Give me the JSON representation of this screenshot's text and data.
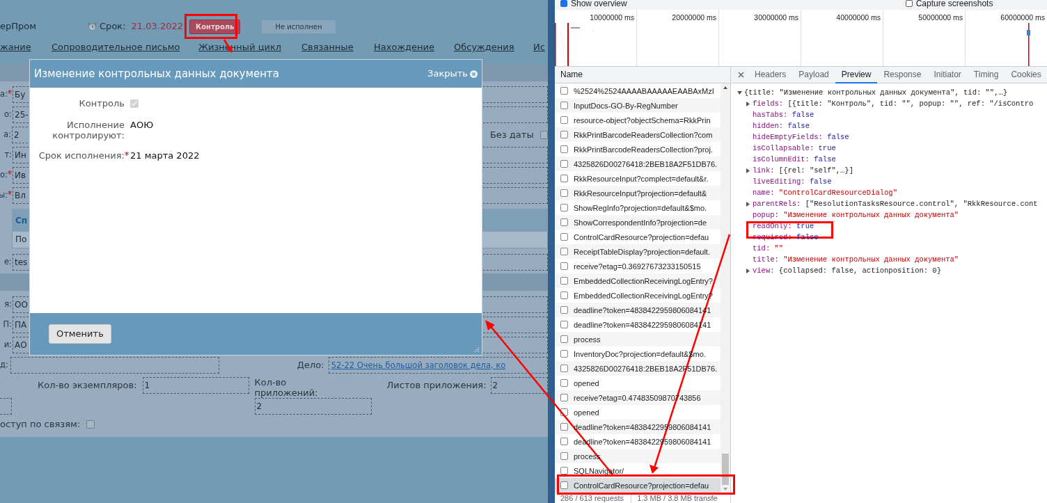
{
  "page": {
    "header": {
      "org": "ерПром",
      "deadline_label": "Срок:",
      "deadline": "21.03.2022",
      "control_button": "Контроль",
      "status": "Не исполнен"
    },
    "tabs": [
      {
        "label": "жание"
      },
      {
        "label": "Сопроводительное письмо"
      },
      {
        "label": "Жизненный цикл"
      },
      {
        "label": "Связанные"
      },
      {
        "label": "Нахождение"
      },
      {
        "label": "Обсуждения"
      },
      {
        "label": "Ис"
      }
    ],
    "form_rows": [
      {
        "label": "а:",
        "required": true,
        "value": "Бу"
      },
      {
        "label": "о:",
        "required": false,
        "value": "25-"
      },
      {
        "label": "а:",
        "required": false,
        "value": "2"
      },
      {
        "label": "т:",
        "required": false,
        "value": "Ин"
      },
      {
        "label": "о:",
        "required": true,
        "value": "Ив"
      },
      {
        "label": "ы:",
        "required": true,
        "value": "Вл"
      }
    ],
    "no_date": {
      "label": "Без даты",
      "checked": false
    },
    "table": {
      "header": "Сп",
      "row": "По"
    },
    "note_row": {
      "label": "е:",
      "value": "tes"
    },
    "second_rows": [
      {
        "label": "я:",
        "value": "ОО"
      },
      {
        "label": "П:",
        "value": "ПА"
      },
      {
        "label": "и:",
        "value": "АО"
      }
    ],
    "case_row": {
      "label": "д:",
      "case_label": "Дело:",
      "case_link": "52-22 Очень большой заголовок дела, ко"
    },
    "counts": [
      {
        "label": "Кол-во экземпляров:",
        "value": "1"
      },
      {
        "label": "Кол-во приложений:",
        "value": "2"
      },
      {
        "label": "Листов приложения:",
        "value": "2"
      }
    ],
    "access": {
      "label": "оступ по связям:",
      "checked": false
    }
  },
  "dialog": {
    "title": "Изменение контрольных данных документа",
    "close": "Закрыть",
    "fields": [
      {
        "kind": "checkbox",
        "label": "Контроль",
        "checked": true,
        "disabled": true
      },
      {
        "kind": "text",
        "label": "Исполнение контролируют:",
        "required": false,
        "value": "АОЮ"
      },
      {
        "kind": "text",
        "label": "Срок исполнения:",
        "required": true,
        "value": "21 марта 2022"
      }
    ],
    "cancel": "Отменить"
  },
  "devtools": {
    "options": [
      {
        "label": "Show overview",
        "checked": true
      },
      {
        "label": "Capture screenshots",
        "checked": false
      }
    ],
    "timeline_ticks": [
      "10000000 ms",
      "20000000 ms",
      "30000000 ms",
      "40000000 ms",
      "50000000 ms",
      "60000000 ms"
    ],
    "name_header": "Name",
    "requests": [
      {
        "name": "%2524%2524AAAABAAAAAEAABAxMzI",
        "selected": false
      },
      {
        "name": "InputDocs-GO-By-RegNumber",
        "selected": false
      },
      {
        "name": "resource-object?objectSchema=RkkPrin",
        "selected": false
      },
      {
        "name": "RkkPrintBarcodeReadersCollection?com",
        "selected": false
      },
      {
        "name": "RkkPrintBarcodeReadersCollection?proj.",
        "selected": false
      },
      {
        "name": "4325826D00276418:2BEB18A2F51DB76.",
        "selected": false
      },
      {
        "name": "RkkResourceInput?complect=default&r.",
        "selected": false
      },
      {
        "name": "RkkResourceInput?projection=default&",
        "selected": false
      },
      {
        "name": "ShowRegInfo?projection=default&$mo.",
        "selected": false
      },
      {
        "name": "ShowCorrespondentInfo?projection=de",
        "selected": false
      },
      {
        "name": "ControlCardResource?projection=defau",
        "selected": false
      },
      {
        "name": "ReceiptTableDisplay?projection=default.",
        "selected": false
      },
      {
        "name": "receive?etag=0.36927673233150515",
        "selected": false
      },
      {
        "name": "EmbeddedCollectionReceivingLogEntry?",
        "selected": false
      },
      {
        "name": "EmbeddedCollectionReceivingLogEntry?",
        "selected": false
      },
      {
        "name": "deadline?token=4838422959806084141",
        "selected": false
      },
      {
        "name": "deadline?token=4838422959806084141",
        "selected": false
      },
      {
        "name": "process",
        "selected": false
      },
      {
        "name": "InventoryDoc?projection=default&$mo.",
        "selected": false
      },
      {
        "name": "4325826D00276418:2BEB18A2F51DB76.",
        "selected": false
      },
      {
        "name": "opened",
        "selected": false
      },
      {
        "name": "receive?etag=0.47483509870743856",
        "selected": false
      },
      {
        "name": "opened",
        "selected": false
      },
      {
        "name": "deadline?token=4838422959806084141",
        "selected": false
      },
      {
        "name": "deadline?token=4838422959806084141",
        "selected": false
      },
      {
        "name": "process",
        "selected": false
      },
      {
        "name": "SQLNavigator/",
        "selected": false
      },
      {
        "name": "ControlCardResource?projection=defau",
        "selected": true
      }
    ],
    "tabs": [
      {
        "label": "Headers",
        "selected": false
      },
      {
        "label": "Payload",
        "selected": false
      },
      {
        "label": "Preview",
        "selected": true
      },
      {
        "label": "Response",
        "selected": false
      },
      {
        "label": "Initiator",
        "selected": false
      },
      {
        "label": "Timing",
        "selected": false
      },
      {
        "label": "Cookies",
        "selected": false
      }
    ],
    "preview": {
      "text": "{title: \"Изменение контрольных данных документа\", tid: \"\",…}",
      "expanded": true,
      "children": [
        {
          "key": "fields:",
          "value": "[{title: \"Контроль\", tid: \"\", popup: \"\", ref: \"/isContro",
          "kind": "object",
          "expanded": false
        },
        {
          "key": "hasTabs:",
          "value": "false",
          "kind": "keyword"
        },
        {
          "key": "hidden:",
          "value": "false",
          "kind": "keyword"
        },
        {
          "key": "hideEmptyFields:",
          "value": "false",
          "kind": "keyword"
        },
        {
          "key": "isCollapsable:",
          "value": "true",
          "kind": "keyword"
        },
        {
          "key": "isColumnEdit:",
          "value": "false",
          "kind": "keyword"
        },
        {
          "key": "link:",
          "value": "[{rel: \"self\",…}]",
          "kind": "object",
          "expanded": false
        },
        {
          "key": "liveEditing:",
          "value": "false",
          "kind": "keyword"
        },
        {
          "key": "name:",
          "value": "\"ControlCardResourceDialog\"",
          "kind": "string"
        },
        {
          "key": "parentRels:",
          "value": "[\"ResolutionTasksResource.control\", \"RkkResource.cont",
          "kind": "object",
          "expanded": false
        },
        {
          "key": "popup:",
          "value": "\"Изменение контрольных данных документа\"",
          "kind": "string"
        },
        {
          "key": "readOnly:",
          "value": "true",
          "kind": "keyword"
        },
        {
          "key": "required:",
          "value": "false",
          "kind": "keyword"
        },
        {
          "key": "tid:",
          "value": "\"\"",
          "kind": "string"
        },
        {
          "key": "title:",
          "value": "\"Изменение контрольных данных документа\"",
          "kind": "string"
        },
        {
          "key": "view:",
          "value": "{collapsed: false, actionposition: 0}",
          "kind": "object",
          "expanded": false
        }
      ]
    },
    "status": [
      "286 / 613 requests",
      "1.3 MB / 3.8 MB transfe"
    ]
  }
}
